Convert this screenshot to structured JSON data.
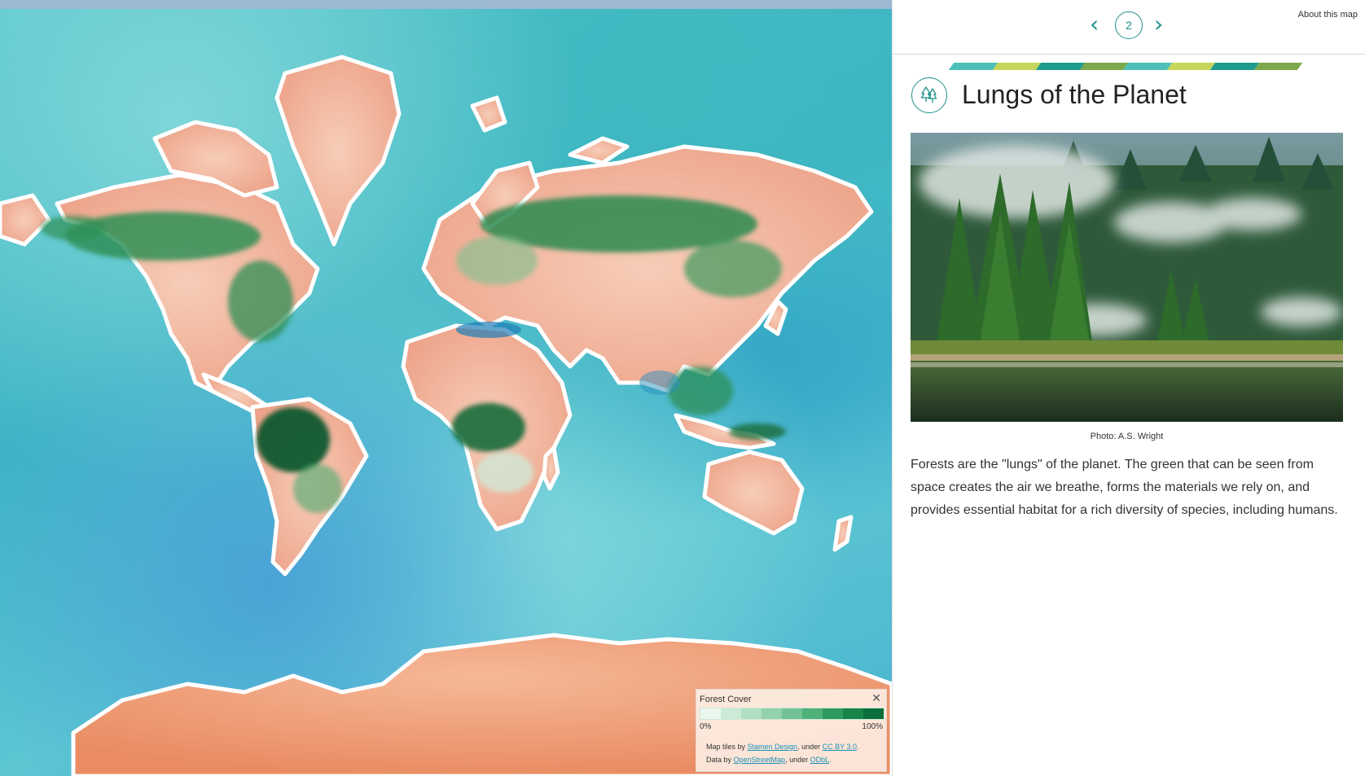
{
  "map": {
    "legend": {
      "title": "Forest Cover",
      "close_icon": "close-icon",
      "min_label": "0%",
      "max_label": "100%",
      "scale_colors": [
        "#eaf6ee",
        "#cbebd6",
        "#b0dfc2",
        "#93d2ac",
        "#72c294",
        "#4fb07a",
        "#2e9a5f",
        "#17844a",
        "#0a6f3a"
      ],
      "credits_line1": {
        "prefix": "Map tiles by ",
        "link1": "Stamen Design",
        "mid": ", under ",
        "link2": "CC BY 3.0",
        "suffix": "."
      },
      "credits_line2": {
        "prefix": "Data by ",
        "link1": "OpenStreetMap",
        "mid": ", under ",
        "link2": "ODbL",
        "suffix": "."
      }
    }
  },
  "sidebar": {
    "nav": {
      "prev_icon": "chevron-left-icon",
      "page_number": "2",
      "next_icon": "chevron-right-icon",
      "prev_glyph": "‹",
      "next_glyph": "›",
      "about_label": "About this map"
    },
    "stripe_colors": [
      "#4cbfb8",
      "#c5d65b",
      "#1e9b8e",
      "#7aa84a",
      "#4cbfb8",
      "#c5d65b",
      "#1e9b8e",
      "#7aa84a"
    ],
    "title_icon": "forest-tree-icon",
    "title": "Lungs of the Planet",
    "photo_caption": "Photo: A.S. Wright",
    "body": "Forests are the \"lungs\" of the planet. The green that can be seen from space creates the air we breathe, forms the materials we rely on, and provides essential habitat for a rich diversity of species, including humans."
  },
  "colors": {
    "accent": "#1e8f8c",
    "ocean": "#45b8c6",
    "land": "#f0b8a0",
    "forest": "#1f7a45"
  }
}
